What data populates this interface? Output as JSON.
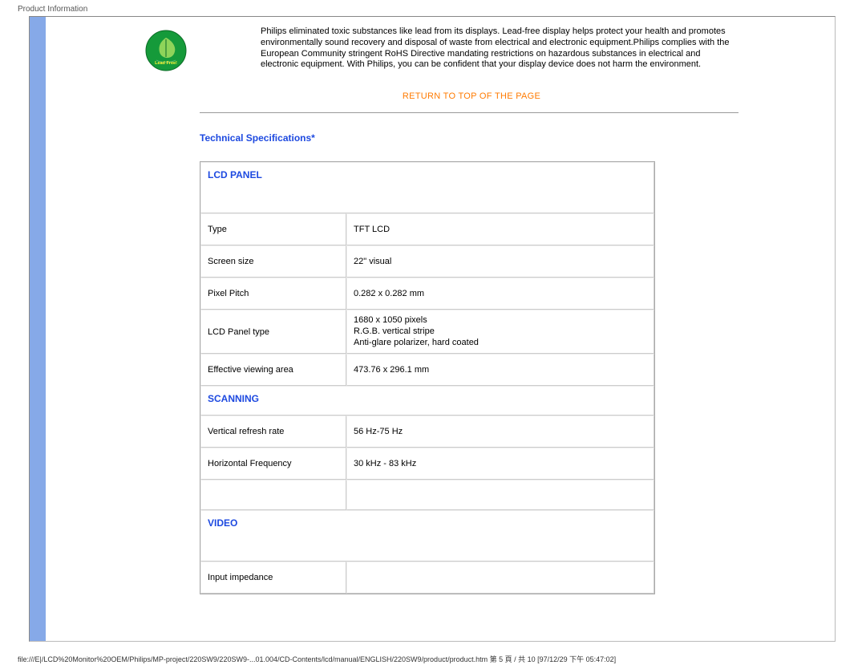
{
  "header": {
    "label": "Product Information"
  },
  "intro": {
    "icon_name": "lead-free-icon",
    "text": "Philips eliminated toxic substances like lead from its displays. Lead-free display helps protect your health and promotes environmentally sound recovery and disposal of waste from electrical and electronic equipment.Philips complies with the European Community stringent RoHS Directive mandating restrictions on hazardous substances in electrical and electronic equipment. With Philips, you can be confident that your display device does not harm the environment."
  },
  "return_link": "RETURN TO TOP OF THE PAGE",
  "section_title": "Technical Specifications*",
  "spec_sections": [
    {
      "header": "LCD PANEL",
      "header_tall": true,
      "rows": [
        {
          "label": "Type",
          "value": "TFT LCD"
        },
        {
          "label": "Screen size",
          "value": "22\" visual"
        },
        {
          "label": "Pixel Pitch",
          "value": "0.282 x 0.282 mm"
        },
        {
          "label": "LCD Panel type",
          "value": "1680 x 1050 pixels\nR.G.B. vertical stripe\nAnti-glare polarizer, hard coated"
        },
        {
          "label": "Effective viewing area",
          "value": "473.76 x 296.1 mm"
        }
      ]
    },
    {
      "header": "SCANNING",
      "header_tall": false,
      "rows": [
        {
          "label": "Vertical refresh rate",
          "value": "56 Hz-75 Hz"
        },
        {
          "label": "Horizontal Frequency",
          "value": "30 kHz - 83 kHz"
        },
        {
          "label": "",
          "value": ""
        }
      ]
    },
    {
      "header": "VIDEO",
      "header_tall": true,
      "rows": [
        {
          "label": "Input impedance",
          "value": ""
        }
      ]
    }
  ],
  "footer": "file:///E|/LCD%20Monitor%20OEM/Philips/MP-project/220SW9/220SW9-...01.004/CD-Contents/lcd/manual/ENGLISH/220SW9/product/product.htm 第 5 頁 / 共 10  [97/12/29 下午 05:47:02]",
  "colors": {
    "accent_blue": "#1d49e0",
    "accent_orange": "#ff7a00",
    "sidebar": "#86a9e8"
  }
}
